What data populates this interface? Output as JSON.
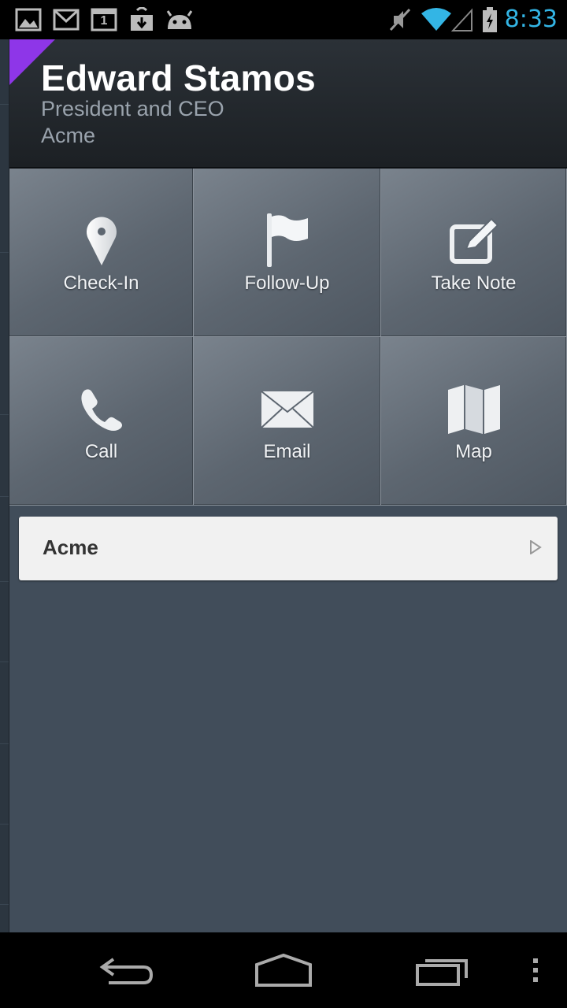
{
  "status_bar": {
    "time": "8:33",
    "time_color": "#33b5e5",
    "left_icons": [
      "gallery-icon",
      "gmail-icon",
      "calendar-icon",
      "download-icon",
      "android-icon"
    ],
    "calendar_day": "1",
    "right_icons": [
      "mute-icon",
      "wifi-icon",
      "signal-icon",
      "battery-charging-icon"
    ]
  },
  "header": {
    "name": "Edward Stamos",
    "title": "President and CEO",
    "company": "Acme",
    "accent_color": "#8e36e8"
  },
  "actions": [
    {
      "label": "Check-In",
      "icon": "map-pin-icon"
    },
    {
      "label": "Follow-Up",
      "icon": "flag-icon"
    },
    {
      "label": "Take Note",
      "icon": "edit-note-icon"
    },
    {
      "label": "Call",
      "icon": "phone-icon"
    },
    {
      "label": "Email",
      "icon": "envelope-icon"
    },
    {
      "label": "Map",
      "icon": "map-icon"
    }
  ],
  "account": {
    "name": "Acme"
  },
  "nav_bar": {
    "buttons": [
      "back-icon",
      "home-icon",
      "recent-apps-icon",
      "overflow-menu-icon"
    ]
  }
}
